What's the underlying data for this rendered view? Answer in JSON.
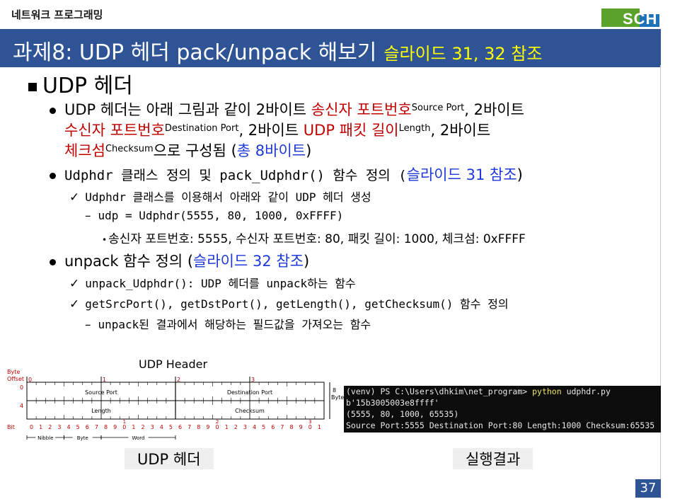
{
  "course": "네트워크 프로그래밍",
  "logo": "SCH",
  "title": {
    "main": "과제8: UDP 헤더 pack/unpack 해보기",
    "ref": "슬라이드 31, 32 참조"
  },
  "heading": "UDP 헤더",
  "bullet1": {
    "l1_a": "UDP 헤더는 아래 그림과 같이 2바이트 ",
    "l1_red": "송신자 포트번호",
    "l1_sup": "Source Port",
    "l1_b": ", 2바이트",
    "l2_red": "수신자 포트번호",
    "l2_sup": "Destination Port",
    "l2_a": ", 2바이트 ",
    "l2_red2": "UDP 패킷 길이",
    "l2_sup2": "Length",
    "l2_b": ", 2바이트",
    "l3_red": "체크섬",
    "l3_sup": "Checksum",
    "l3_a": "으로 구성됨 (",
    "l3_blue": "총 8바이트",
    "l3_b": ")"
  },
  "bullet2": {
    "a": "Udphdr 클래스 정의 및 pack_Udphdr() 함수 정의 (",
    "blue": "슬라이드 31 참조",
    "b": ")",
    "check1": "Udphdr 클래스를 이용해서 아래와 같이 UDP 헤더 생성",
    "dash1": "udp = Udphdr(5555, 80, 1000, 0xFFFF)",
    "dot1": "송신자 포트번호: 5555, 수신자 포트번호: 80, 패킷 길이: 1000, 체크섬: 0xFFFF"
  },
  "bullet3": {
    "a": "unpack 함수 정의 (",
    "blue": "슬라이드 32 참조",
    "b": ")",
    "check1": "unpack_Udphdr(): UDP 헤더를 unpack하는 함수",
    "check2": "getSrcPort(), getDstPort(), getLength(), getChecksum() 함수 정의",
    "dash1": "unpack된 결과에서 해당하는 필드값을 가져오는 함수"
  },
  "diagram": {
    "title": "UDP Header",
    "byte_offset_label": "Byte\nOffset",
    "offsets": [
      "0",
      "4"
    ],
    "byte_marks": [
      "0",
      "1",
      "2",
      "3"
    ],
    "fields": [
      "Source Port",
      "Destination Port",
      "Length",
      "Checksum"
    ],
    "size_label": [
      "8",
      "Bytes"
    ],
    "bit_label": "Bit",
    "bits": [
      "0",
      "1",
      "2",
      "3",
      "4",
      "5",
      "6",
      "7",
      "8",
      "9",
      "0",
      "1",
      "2",
      "3",
      "4",
      "5",
      "6",
      "7",
      "8",
      "9",
      "0",
      "1",
      "2",
      "3",
      "4",
      "5",
      "6",
      "7",
      "8",
      "9",
      "0",
      "1"
    ],
    "decade_marks": [
      "1",
      "2",
      "3"
    ],
    "legend": [
      "Nibble",
      "Byte",
      "Word"
    ]
  },
  "captions": {
    "left": "UDP 헤더",
    "right": "실행결과"
  },
  "terminal": {
    "prompt": "(venv) PS C:\\Users\\dhkim\\net_program> ",
    "cmd": "python",
    "arg": " udphdr.py",
    "line2": "b'15b3005003e8ffff'",
    "line3": "(5555, 80, 1000, 65535)",
    "line4": "Source Port:5555 Destination Port:80 Length:1000 Checksum:65535"
  },
  "page_number": "37",
  "colors": {
    "title_bg": "#2f5496",
    "title_ref": "#ffff00",
    "red": "#c00000",
    "blue": "#1f3ad8",
    "logo_green": "#5aa22b",
    "logo_blue": "#1e73b8"
  }
}
